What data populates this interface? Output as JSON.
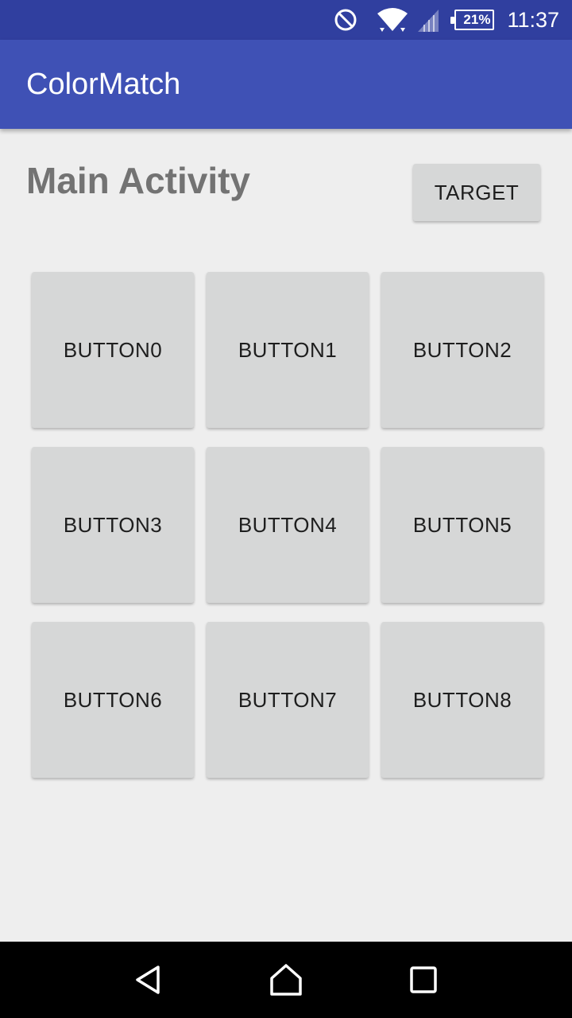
{
  "status_bar": {
    "icons": [
      "do-not-disturb-icon",
      "wifi-icon",
      "cell-signal-icon",
      "battery-icon"
    ],
    "battery_percent": "21%",
    "time": "11:37"
  },
  "app_bar": {
    "title": "ColorMatch",
    "color": "#3f51b5"
  },
  "main": {
    "heading": "Main Activity",
    "target_label": "TARGET",
    "buttons": [
      "BUTTON0",
      "BUTTON1",
      "BUTTON2",
      "BUTTON3",
      "BUTTON4",
      "BUTTON5",
      "BUTTON6",
      "BUTTON7",
      "BUTTON8"
    ]
  },
  "nav_bar": {
    "icons": [
      "back-icon",
      "home-icon",
      "recents-icon"
    ]
  },
  "colors": {
    "status_bar": "#303f9f",
    "primary": "#3f51b5",
    "background": "#eeeeee",
    "button": "#d6d7d7"
  }
}
